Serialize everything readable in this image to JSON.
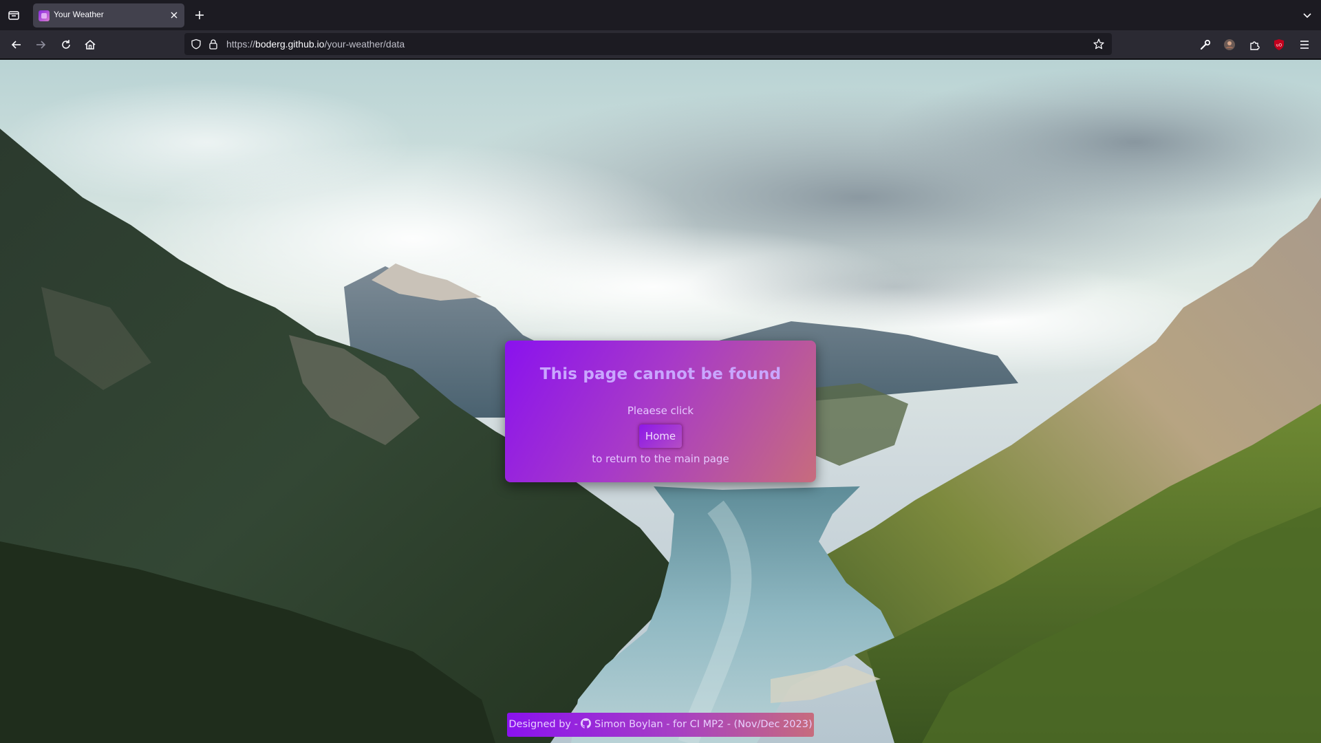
{
  "browser": {
    "tab": {
      "title": "Your Weather",
      "favicon": "purple-weather-favicon"
    },
    "url": {
      "prefix": "https://",
      "domain": "boderg.github.io",
      "path": "/your-weather/data"
    },
    "icons": {
      "tab_list": "tab-list-icon",
      "close_tab": "close-icon",
      "new_tab": "plus-icon",
      "tabs_overflow": "chevron-down-icon",
      "back": "back-arrow-icon",
      "forward": "forward-arrow-icon",
      "reload": "reload-icon",
      "home": "home-icon",
      "tracking_protection": "shield-icon",
      "secure": "lock-icon",
      "bookmark": "star-icon",
      "devtools": "wrench-icon",
      "account": "avatar-icon",
      "extensions": "puzzle-icon",
      "ublock": "ublock-icon",
      "menu": "hamburger-menu-icon"
    }
  },
  "page": {
    "background": "mountain-lake-valley-photo",
    "card": {
      "title": "This page cannot be found",
      "line1": "Pleaese click",
      "home_button": "Home",
      "line2": "to return to the main page"
    },
    "footer": {
      "prefix": "Designed by - ",
      "author": "Simon Boylan",
      "suffix": " - for CI MP2 - (Nov/Dec 2023)",
      "icon": "github-icon"
    }
  },
  "colors": {
    "card_gradient_start": "#8a12ee",
    "card_gradient_end": "#c76c7d",
    "title_text": "#c9a6ff",
    "browser_dark": "#1c1b22",
    "browser_toolbar": "#2b2a33"
  }
}
